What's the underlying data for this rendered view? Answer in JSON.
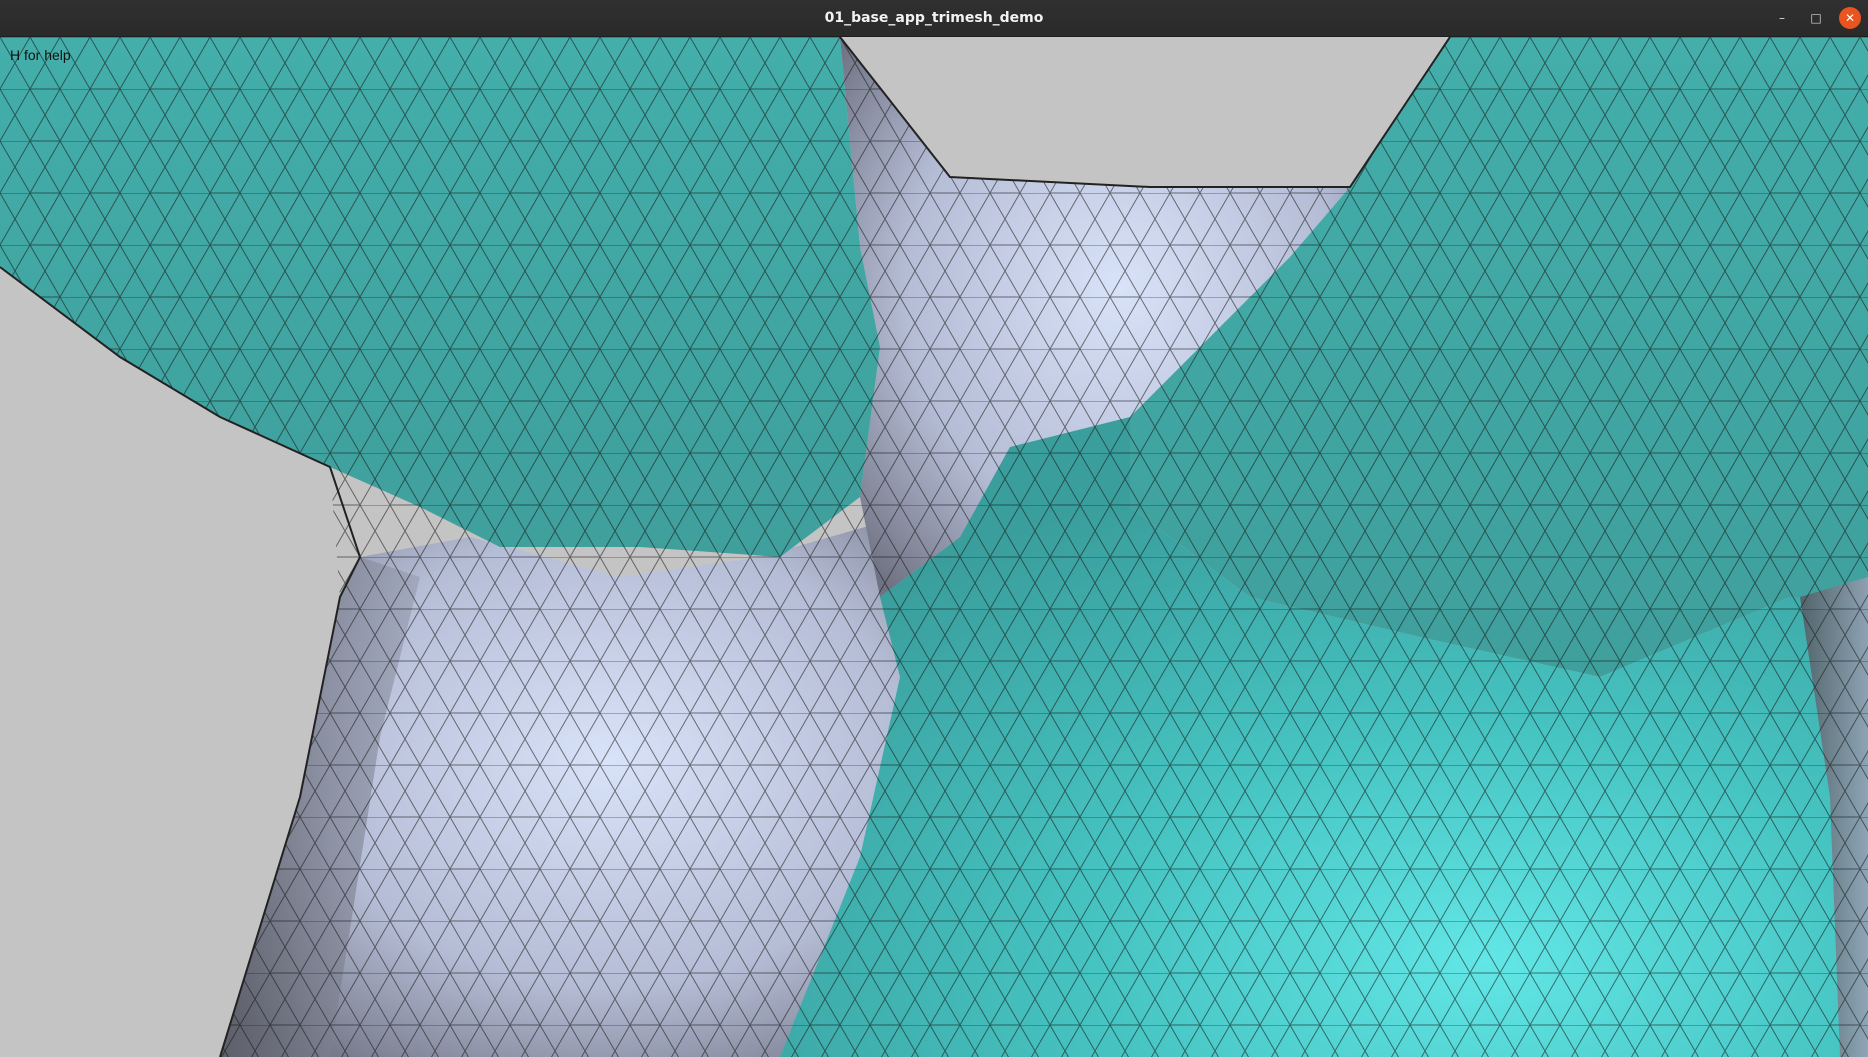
{
  "window": {
    "title": "01_base_app_trimesh_demo",
    "controls": {
      "minimize": "–",
      "maximize": "□",
      "close": "✕"
    }
  },
  "viewport": {
    "help_text": "H for help",
    "background_color": "#c4c4c4",
    "mesh_colors": {
      "teal": "#46b7b2",
      "teal_bright": "#62e6e6",
      "lavender": "#c3cce4",
      "lavender_dark": "#6f7282",
      "edges": "#111111"
    }
  }
}
